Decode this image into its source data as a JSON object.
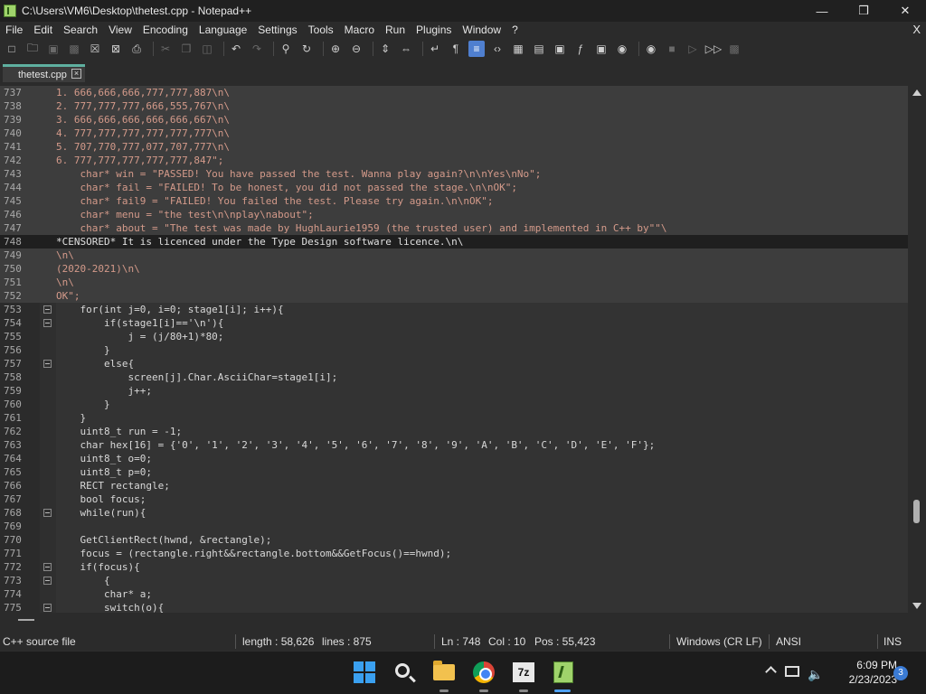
{
  "window": {
    "title": "C:\\Users\\VM6\\Desktop\\thetest.cpp - Notepad++",
    "minimize_glyph": "—",
    "maximize_glyph": "❒",
    "close_glyph": "✕"
  },
  "menu": {
    "items": [
      "File",
      "Edit",
      "Search",
      "View",
      "Encoding",
      "Language",
      "Settings",
      "Tools",
      "Macro",
      "Run",
      "Plugins",
      "Window",
      "?"
    ],
    "close_doc": "X"
  },
  "toolbar": {
    "icons": [
      "new-file-icon",
      "open-file-icon",
      "save-icon",
      "save-all-icon",
      "close-icon",
      "close-all-icon",
      "print-icon",
      "cut-icon",
      "copy-icon",
      "paste-icon",
      "undo-icon",
      "redo-icon",
      "find-icon",
      "replace-icon",
      "zoom-in-icon",
      "zoom-out-icon",
      "sync-vertical-icon",
      "sync-horizontal-icon",
      "word-wrap-icon",
      "show-all-chars-icon",
      "indent-guide-icon",
      "xml-icon",
      "doc-map-icon",
      "function-list-icon",
      "folder-as-workspace-icon",
      "fx-icon",
      "monitor-icon",
      "screenshot-icon",
      "record-macro-icon",
      "stop-macro-icon",
      "play-macro-icon",
      "run-macro-multiple-icon",
      "save-macro-icon"
    ]
  },
  "tab": {
    "label": "thetest.cpp",
    "close": "×"
  },
  "editor": {
    "lines": [
      {
        "n": "737",
        "t": "1. 666,666,666,777,777,887\\n\\",
        "cls": "str-block",
        "fold": false
      },
      {
        "n": "738",
        "t": "2. 777,777,777,666,555,767\\n\\",
        "cls": "str-block",
        "fold": false
      },
      {
        "n": "739",
        "t": "3. 666,666,666,666,666,667\\n\\",
        "cls": "str-block",
        "fold": false
      },
      {
        "n": "740",
        "t": "4. 777,777,777,777,777,777\\n\\",
        "cls": "str-block",
        "fold": false
      },
      {
        "n": "741",
        "t": "5. 707,770,777,077,707,777\\n\\",
        "cls": "str-block",
        "fold": false
      },
      {
        "n": "742",
        "t": "6. 777,777,777,777,777,847\";",
        "cls": "str-block",
        "fold": false
      },
      {
        "n": "743",
        "t": "    char* win = \"PASSED! You have passed the test. Wanna play again?\\n\\nYes\\nNo\";",
        "cls": "str-block",
        "fold": false
      },
      {
        "n": "744",
        "t": "    char* fail = \"FAILED! To be honest, you did not passed the stage.\\n\\nOK\";",
        "cls": "str-block",
        "fold": false
      },
      {
        "n": "745",
        "t": "    char* fail9 = \"FAILED! You failed the test. Please try again.\\n\\nOK\";",
        "cls": "str-block",
        "fold": false
      },
      {
        "n": "746",
        "t": "    char* menu = \"the test\\n\\nplay\\nabout\";",
        "cls": "str-block",
        "fold": false
      },
      {
        "n": "747",
        "t": "    char* about = \"The test was made by HughLaurie1959 (the trusted user) and implemented in C++ by\"\"\\",
        "cls": "str-block",
        "fold": false
      },
      {
        "n": "748",
        "t": "*CENSORED* It is licenced under the Type Design software licence.\\n\\",
        "cls": "current",
        "fold": false
      },
      {
        "n": "749",
        "t": "\\n\\",
        "cls": "str-block",
        "fold": false
      },
      {
        "n": "750",
        "t": "(2020-2021)\\n\\",
        "cls": "str-block",
        "fold": false
      },
      {
        "n": "751",
        "t": "\\n\\",
        "cls": "str-block",
        "fold": false
      },
      {
        "n": "752",
        "t": "OK\";",
        "cls": "str-block",
        "fold": false
      },
      {
        "n": "753",
        "t": "    for(int j=0, i=0; stage1[i]; i++){",
        "cls": "",
        "fold": true
      },
      {
        "n": "754",
        "t": "        if(stage1[i]=='\\n'){",
        "cls": "",
        "fold": true
      },
      {
        "n": "755",
        "t": "            j = (j/80+1)*80;",
        "cls": "",
        "fold": false
      },
      {
        "n": "756",
        "t": "        }",
        "cls": "",
        "fold": false
      },
      {
        "n": "757",
        "t": "        else{",
        "cls": "",
        "fold": true
      },
      {
        "n": "758",
        "t": "            screen[j].Char.AsciiChar=stage1[i];",
        "cls": "",
        "fold": false
      },
      {
        "n": "759",
        "t": "            j++;",
        "cls": "",
        "fold": false
      },
      {
        "n": "760",
        "t": "        }",
        "cls": "",
        "fold": false
      },
      {
        "n": "761",
        "t": "    }",
        "cls": "",
        "fold": false
      },
      {
        "n": "762",
        "t": "    uint8_t run = -1;",
        "cls": "",
        "fold": false
      },
      {
        "n": "763",
        "t": "    char hex[16] = {'0', '1', '2', '3', '4', '5', '6', '7', '8', '9', 'A', 'B', 'C', 'D', 'E', 'F'};",
        "cls": "",
        "fold": false
      },
      {
        "n": "764",
        "t": "    uint8_t o=0;",
        "cls": "",
        "fold": false
      },
      {
        "n": "765",
        "t": "    uint8_t p=0;",
        "cls": "",
        "fold": false
      },
      {
        "n": "766",
        "t": "    RECT rectangle;",
        "cls": "",
        "fold": false
      },
      {
        "n": "767",
        "t": "    bool focus;",
        "cls": "",
        "fold": false
      },
      {
        "n": "768",
        "t": "    while(run){",
        "cls": "",
        "fold": true
      },
      {
        "n": "769",
        "t": "",
        "cls": "",
        "fold": false
      },
      {
        "n": "770",
        "t": "    GetClientRect(hwnd, &rectangle);",
        "cls": "",
        "fold": false
      },
      {
        "n": "771",
        "t": "    focus = (rectangle.right&&rectangle.bottom&&GetFocus()==hwnd);",
        "cls": "",
        "fold": false
      },
      {
        "n": "772",
        "t": "    if(focus){",
        "cls": "",
        "fold": true
      },
      {
        "n": "773",
        "t": "        {",
        "cls": "",
        "fold": true
      },
      {
        "n": "774",
        "t": "        char* a;",
        "cls": "",
        "fold": false
      },
      {
        "n": "775",
        "t": "        switch(o){",
        "cls": "",
        "fold": true
      }
    ]
  },
  "statusbar": {
    "file_type": "C++ source file",
    "length": "length : 58,626",
    "lines": "lines : 875",
    "ln": "Ln : 748",
    "col": "Col : 10",
    "pos": "Pos : 55,423",
    "eol": "Windows (CR LF)",
    "encoding": "ANSI",
    "mode": "INS"
  },
  "taskbar": {
    "apps": [
      "start-icon",
      "search-icon",
      "file-explorer-icon",
      "chrome-icon",
      "7zip-icon",
      "notepadpp-icon"
    ],
    "sevenzip_label": "7z",
    "volume_glyph": "🔈",
    "time": "6:09 PM",
    "date": "2/23/2023",
    "notification_count": "3"
  }
}
